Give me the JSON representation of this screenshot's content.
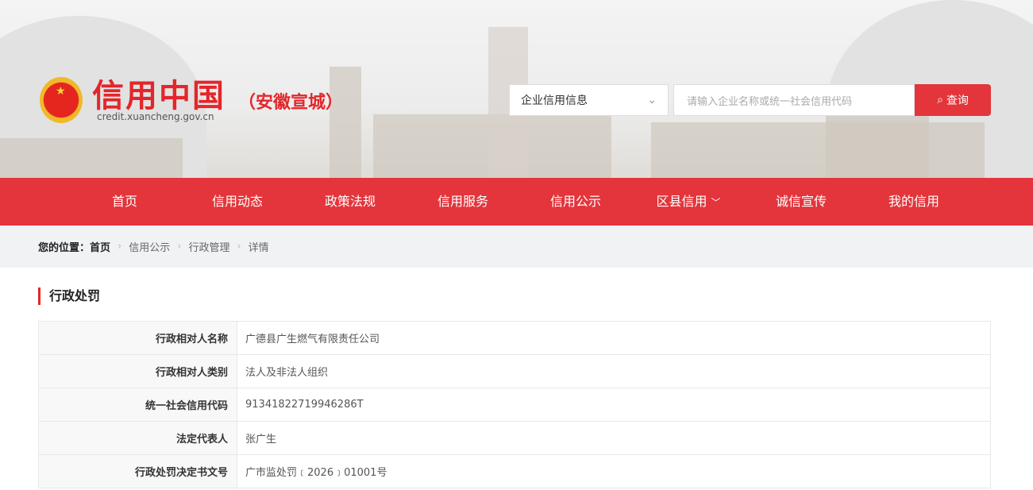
{
  "header": {
    "title": "信用中国",
    "region": "（安徽宣城）",
    "url": "credit.xuancheng.gov.cn"
  },
  "search": {
    "select": "企业信用信息",
    "placeholder": "请输入企业名称或统一社会信用代码",
    "button": "查询"
  },
  "nav": [
    "首页",
    "信用动态",
    "政策法规",
    "信用服务",
    "信用公示",
    "区县信用",
    "诚信宣传",
    "我的信用"
  ],
  "breadcrumb": {
    "prefix": "您的位置：",
    "items": [
      "首页",
      "信用公示",
      "行政管理",
      "详情"
    ]
  },
  "section": "行政处罚",
  "rows": [
    {
      "k": "行政相对人名称",
      "v": "广德县广生燃气有限责任公司"
    },
    {
      "k": "行政相对人类别",
      "v": "法人及非法人组织"
    },
    {
      "k": "统一社会信用代码",
      "v": "91341822719946286T"
    },
    {
      "k": "法定代表人",
      "v": "张广生"
    },
    {
      "k": "行政处罚决定书文号",
      "v": "广市监处罚﹝2026﹞01001号"
    }
  ]
}
